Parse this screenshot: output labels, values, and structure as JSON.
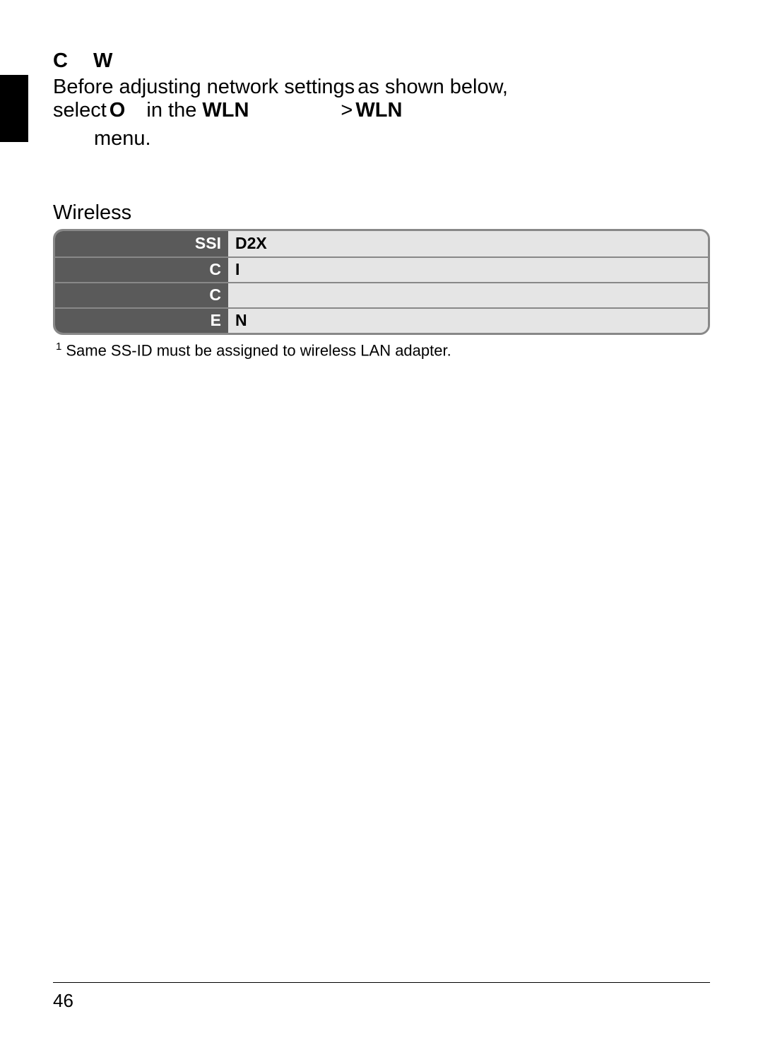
{
  "side_tab": " ",
  "heading": {
    "c": "C",
    "w": "W"
  },
  "paragraph": {
    "part1": "Before adjusting network settings",
    "part2": "as shown below,",
    "part3": "select",
    "opt": "O",
    "part4": " in the ",
    "wln1": "WLN",
    "gt": ">",
    "wln2": "WLN"
  },
  "menu_line": "menu.",
  "section_label": "Wireless",
  "table": {
    "rows": [
      {
        "label": "SSI",
        "value": "D2X"
      },
      {
        "label": "C",
        "value": "I"
      },
      {
        "label": "C",
        "value": ""
      },
      {
        "label": "E",
        "value": "N"
      }
    ]
  },
  "footnote": {
    "sup": "1",
    "text": "Same SS-ID must be assigned to wireless LAN adapter."
  },
  "page_number": "46"
}
